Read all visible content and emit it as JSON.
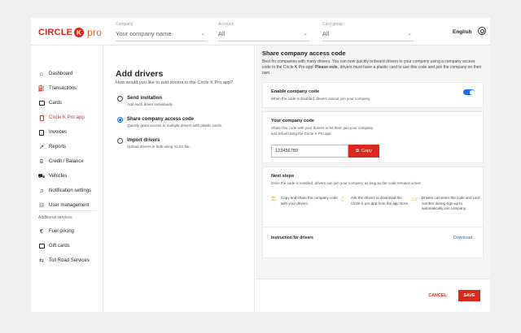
{
  "brand": {
    "name_part1": "CIRCLE",
    "k": "K",
    "name_part2": "pro",
    "color": "#da291c"
  },
  "header": {
    "company": {
      "label": "Company",
      "value": "Your company name"
    },
    "account": {
      "label": "Account",
      "value": "All"
    },
    "card_group": {
      "label": "Card group",
      "value": "All"
    },
    "language": "English"
  },
  "sidebar": {
    "items": [
      {
        "label": "Dashboard",
        "icon": "home-icon"
      },
      {
        "label": "Transactions",
        "icon": "fuel-pump-icon"
      },
      {
        "label": "Cards",
        "icon": "card-icon"
      },
      {
        "label": "Circle K Pro app",
        "icon": "phone-icon",
        "active": true
      },
      {
        "label": "Invoices",
        "icon": "invoice-icon"
      },
      {
        "label": "Reports",
        "icon": "chart-icon"
      },
      {
        "label": "Credit / Balance",
        "icon": "bank-icon"
      },
      {
        "label": "Vehicles",
        "icon": "car-icon"
      },
      {
        "label": "Notification settings",
        "icon": "bell-icon"
      },
      {
        "label": "User management",
        "icon": "users-icon"
      }
    ],
    "section_title": "Additional services",
    "extra_items": [
      {
        "label": "Fuel pricing",
        "icon": "euro-icon"
      },
      {
        "label": "Gift cards",
        "icon": "gift-card-icon"
      },
      {
        "label": "Toll Road Services",
        "icon": "toll-icon"
      }
    ]
  },
  "add_drivers": {
    "title": "Add drivers",
    "subtitle": "How would you like to add drivers to the Circle K Pro app?",
    "options": [
      {
        "title": "Send invitation",
        "desc": "Add each driver individually",
        "selected": false
      },
      {
        "title": "Share company access code",
        "desc": "Quickly grant access to multiple drivers with plastic cards.",
        "selected": true
      },
      {
        "title": "Import drivers",
        "desc": "Upload drivers in bulk using XLSX file.",
        "selected": false
      }
    ]
  },
  "share": {
    "title": "Share company access code",
    "intro_1": "Best for companies with many drivers. You can now quickly onboard drivers to your company using a company access code in the Circle K Pro app!",
    "intro_note": "Please note",
    "intro_2": ", drivers must have a plastic card to use this code and join the company on their own.",
    "enable_title": "Enable company code",
    "enable_desc": "When the code is disabled, drivers cannot join your company.",
    "enabled": true,
    "code_title": "Your company code",
    "code_desc_1": "Share this code with your drivers to let them join your company",
    "code_desc_2": "and refuel using the Circle K Pro app.",
    "code_value": "123456789",
    "copy_label": "Copy",
    "next_title": "Next steps",
    "next_desc": "Once the code is enabled, drivers can join your company as long as the code remains active.",
    "steps": [
      {
        "icon": "key-icon",
        "text": "Copy and share the company code with your drivers."
      },
      {
        "icon": "phone-icon",
        "text": "Ask the drivers to download the Circle K pro app from the app store."
      },
      {
        "icon": "card-icon",
        "text": "Drivers can enter the code and card number during sign-up to automatically join company."
      }
    ],
    "instructions_label": "Instruction for drivers",
    "download_label": "Download"
  },
  "footer": {
    "cancel": "CANCEL",
    "save": "SAVE"
  }
}
